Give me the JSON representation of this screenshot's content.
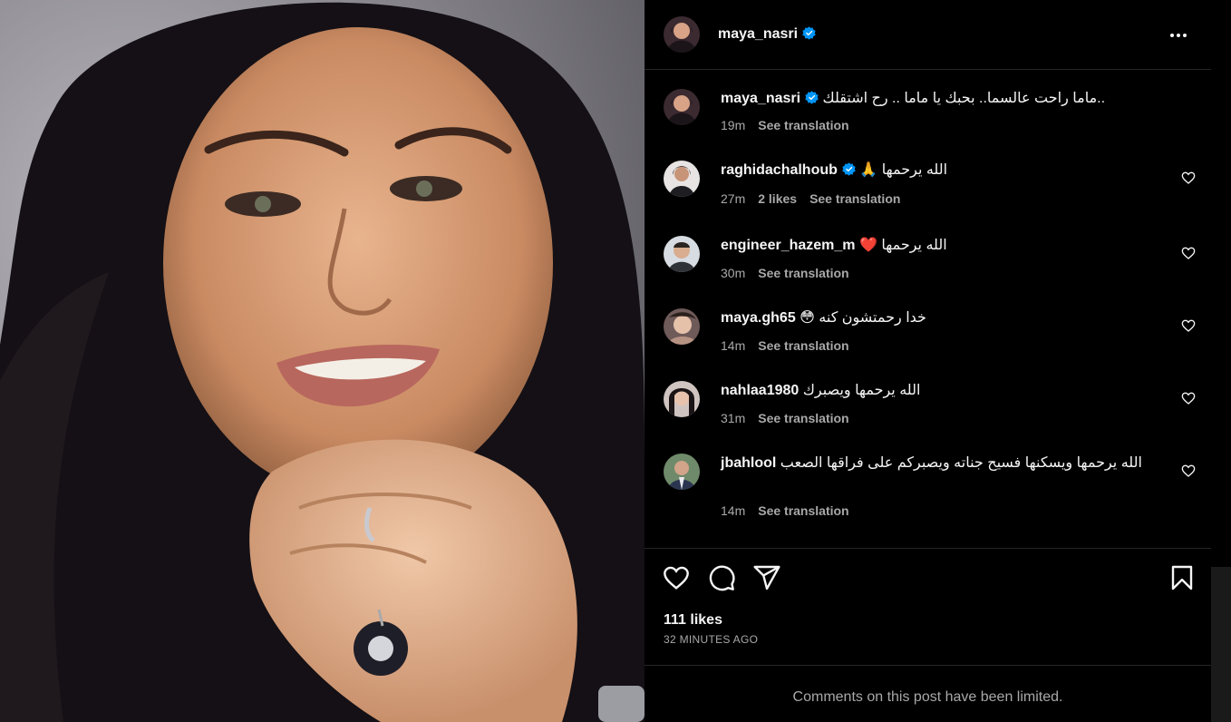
{
  "post": {
    "username": "maya_nasri",
    "verified": true,
    "caption": "..ماما راحت عالسما.. بحبك يا ماما .. رح اشتقلك",
    "caption_time": "19m",
    "see_translation": "See translation",
    "likes_text": "111 likes",
    "time_ago": "32 MINUTES AGO",
    "comments_limited": "Comments on this post have been limited."
  },
  "comments": [
    {
      "username": "raghidachalhoub",
      "verified": true,
      "text": "الله يرحمها 🙏",
      "time": "27m",
      "likes": "2 likes",
      "see_translation": "See translation"
    },
    {
      "username": "engineer_hazem_m",
      "verified": false,
      "text": "الله يرحمها ❤️",
      "time": "30m",
      "likes": "",
      "see_translation": "See translation"
    },
    {
      "username": "maya.gh65",
      "verified": false,
      "text": "خدا رحمتشون کنه 😳",
      "time": "14m",
      "likes": "",
      "see_translation": "See translation"
    },
    {
      "username": "nahlaa1980",
      "verified": false,
      "text": "الله يرحمها ويصبرك",
      "time": "31m",
      "likes": "",
      "see_translation": "See translation"
    },
    {
      "username": "jbahlool",
      "verified": false,
      "text": "الله يرحمها ويسكنها فسيح جناته ويصبركم على فراقها الصعب",
      "time": "14m",
      "likes": "",
      "see_translation": "See translation"
    }
  ],
  "icons": {
    "verified": "verified-badge-icon",
    "more": "more-options-icon",
    "like": "heart-icon",
    "comment": "comment-icon",
    "share": "share-icon",
    "save": "bookmark-icon"
  },
  "colors": {
    "background": "#000000",
    "text": "#f5f5f5",
    "secondary_text": "#a8a8a8",
    "verified_blue": "#0095f6",
    "divider": "#262626"
  }
}
